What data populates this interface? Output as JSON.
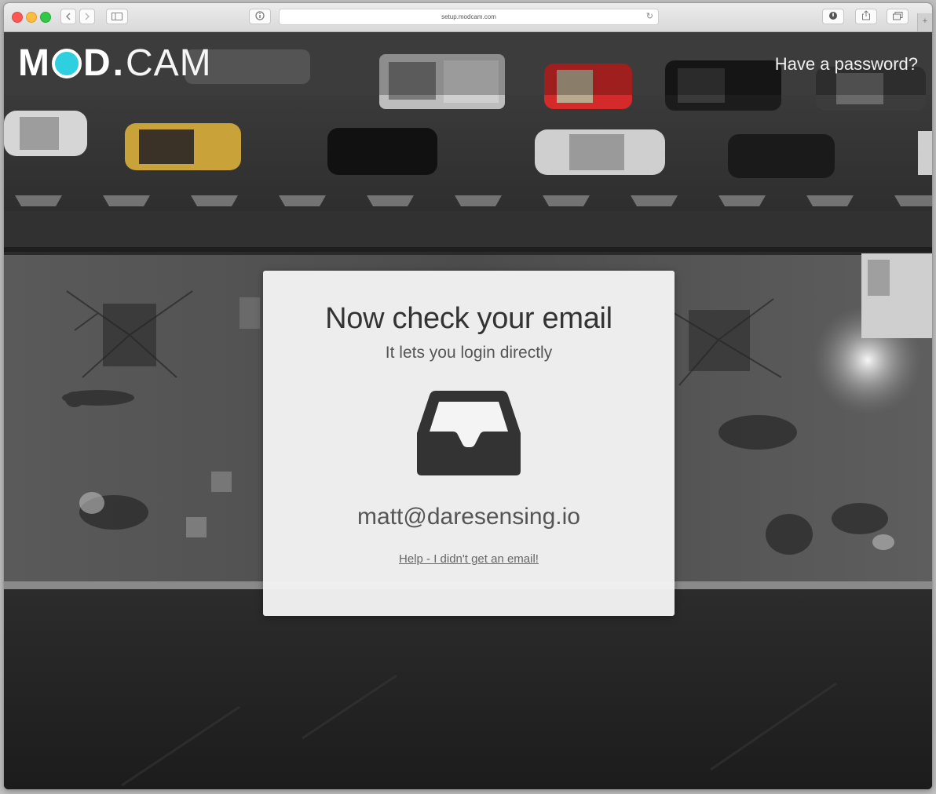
{
  "browser": {
    "url": "setup.modcam.com",
    "nav_back_icon": "chevron-left-icon",
    "nav_forward_icon": "chevron-right-icon",
    "sidebar_icon": "sidebar-icon",
    "info_icon": "info-icon",
    "reload_icon": "reload-icon",
    "share_icon": "share-icon",
    "tabs_icon": "tabs-icon",
    "new_tab_label": "+"
  },
  "header": {
    "brand_left": "M",
    "brand_mid": "D",
    "brand_dot": ".",
    "brand_right": "CAM",
    "have_password_link": "Have a password?"
  },
  "card": {
    "title": "Now check your email",
    "subtitle": "It lets you login directly",
    "icon": "inbox-icon",
    "email": "matt@daresensing.io",
    "help_link": "Help - I didn't get an email!"
  },
  "colors": {
    "brand_accent": "#2ed0e0",
    "card_bg": "#f4f4f4",
    "text_dark": "#333333",
    "taxi": "#c9a23a",
    "red_car": "#d42a2a"
  }
}
